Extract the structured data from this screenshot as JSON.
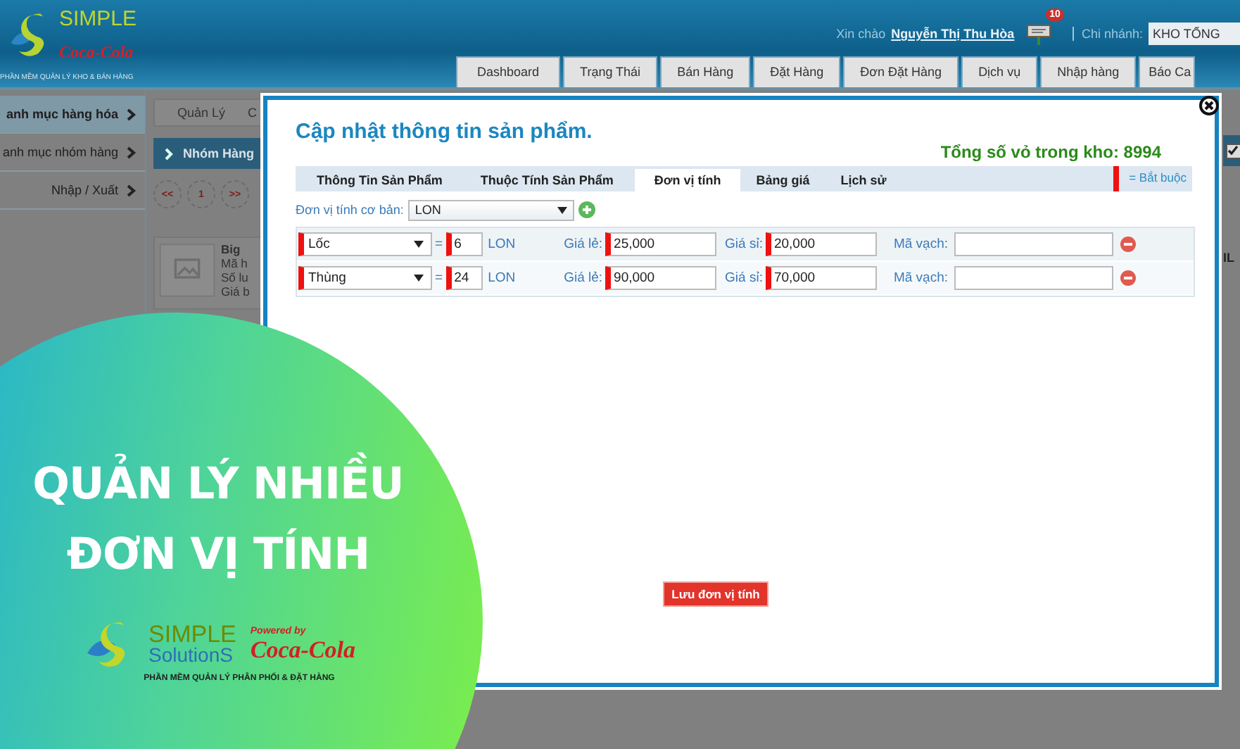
{
  "header": {
    "logo_text": "SIMPLE",
    "logo_brand": "Coca‑Cola",
    "logo_tagline": "PHẦN MỀM QUẢN LÝ KHO & BÁN HÀNG",
    "greeting": "Xin chào",
    "user_name": "Nguyễn Thị Thu Hòa",
    "notification_count": "10",
    "branch_label": "Chi nhánh:",
    "branch_value": "KHO TỔNG"
  },
  "nav": [
    {
      "label": "Dashboard"
    },
    {
      "label": "Trạng Thái"
    },
    {
      "label": "Bán Hàng"
    },
    {
      "label": "Đặt Hàng"
    },
    {
      "label": "Đơn Đặt Hàng"
    },
    {
      "label": "Dịch vụ"
    },
    {
      "label": "Nhập hàng"
    },
    {
      "label": "Báo Ca"
    }
  ],
  "sidebar": {
    "items": [
      {
        "label": "anh mục hàng hóa",
        "selected": true
      },
      {
        "label": "anh mục nhóm hàng",
        "selected": false
      },
      {
        "label": "Nhập / Xuất",
        "selected": false
      }
    ]
  },
  "breadcrumb": [
    "Quản Lý",
    "C"
  ],
  "section_bar": "Nhóm Hàng",
  "pagination": [
    "<<",
    "1",
    ">>"
  ],
  "product_card": {
    "lines": [
      "Big",
      "Mã h",
      "Số lu",
      "Giá b"
    ]
  },
  "right_strip": {
    "checked": true,
    "text": "IL"
  },
  "modal": {
    "title": "Cập nhật thông tin sản phẩm.",
    "stock_total": "Tổng số vỏ trong kho: 8994",
    "tabs": [
      {
        "label": "Thông Tin Sản Phẩm",
        "selected": false
      },
      {
        "label": "Thuộc Tính Sản Phẩm",
        "selected": false
      },
      {
        "label": "Đơn vị tính",
        "selected": true
      },
      {
        "label": "Bảng giá",
        "selected": false
      },
      {
        "label": "Lịch sử",
        "selected": false
      }
    ],
    "required_legend": "= Bắt buộc",
    "base_unit": {
      "label": "Đơn vị tính cơ bản:",
      "value": "LON"
    },
    "units": [
      {
        "unit": "Lốc",
        "equals": "=",
        "quantity": "6",
        "base": "LON",
        "retail_label": "Giá lẻ:",
        "retail": "25,000",
        "wholesale_label": "Giá sỉ:",
        "wholesale": "20,000",
        "barcode_label": "Mã vạch:"
      },
      {
        "unit": "Thùng",
        "equals": "=",
        "quantity": "24",
        "base": "LON",
        "retail_label": "Giá lẻ:",
        "retail": "90,000",
        "wholesale_label": "Giá sỉ:",
        "wholesale": "70,000",
        "barcode_label": "Mã vạch:"
      }
    ],
    "save_button": "Lưu đơn vị tính"
  },
  "promo": {
    "headline": [
      "QUẢN LÝ NHIỀU",
      "ĐƠN VỊ TÍNH"
    ],
    "logo_simple": "SIMPLE",
    "logo_solutions": "SolutionS",
    "powered_by": "Powered by",
    "brand": "Coca‑Cola",
    "tagline": "PHẦN MỀM QUẢN LÝ PHÂN PHỐI & ĐẶT HÀNG"
  }
}
